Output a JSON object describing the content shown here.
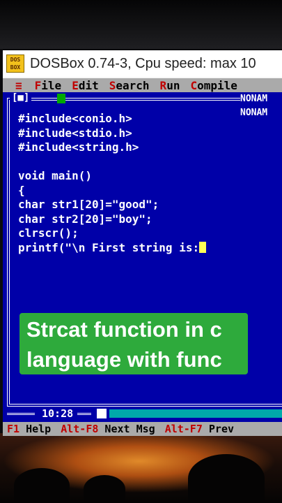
{
  "window": {
    "title": "DOSBox 0.74-3, Cpu speed: max 10",
    "icon_text_top": "DOS",
    "icon_text_bottom": "BOX"
  },
  "menubar": {
    "system": "≡",
    "items": [
      {
        "hot": "F",
        "rest": "ile"
      },
      {
        "hot": "E",
        "rest": "dit"
      },
      {
        "hot": "S",
        "rest": "earch"
      },
      {
        "hot": "R",
        "rest": "un"
      },
      {
        "hot": "C",
        "rest": "ompile"
      }
    ]
  },
  "editor": {
    "window_controls": "[■]",
    "filename_top": "NONAM",
    "filename_bottom": "NONAM",
    "code_lines": [
      "#include<conio.h>",
      "#include<stdio.h>",
      "#include<string.h>",
      "",
      "void main()",
      "{",
      "char str1[20]=\"good\";",
      "char str2[20]=\"boy\";",
      "clrscr();",
      "printf(\"\\n First string is:"
    ],
    "cursor_position": "10:28"
  },
  "fkeys": [
    {
      "hot": "F1",
      "label": " Help"
    },
    {
      "hot": "Alt-F8",
      "label": " Next Msg"
    },
    {
      "hot": "Alt-F7",
      "label": " Prev"
    }
  ],
  "caption": {
    "line1": "Strcat function in c",
    "line2": "language with func"
  },
  "colors": {
    "dos_blue": "#0000a8",
    "menu_gray": "#aaaaaa",
    "hotkey_red": "#c00000",
    "caption_green": "#2eaa3c",
    "cursor_yellow": "#ffff55"
  }
}
